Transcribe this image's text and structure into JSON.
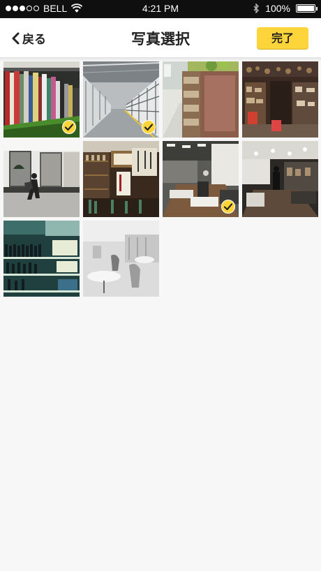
{
  "status_bar": {
    "carrier": "BELL",
    "time": "4:21 PM",
    "battery": "100%"
  },
  "nav": {
    "back_label": "戻る",
    "title": "写真選択",
    "done_label": "完了"
  },
  "photos": [
    {
      "name": "photo-bookshelf",
      "selected": true
    },
    {
      "name": "photo-warehouse-aisle",
      "selected": true
    },
    {
      "name": "photo-store-shelves",
      "selected": false
    },
    {
      "name": "photo-kitchen-shop",
      "selected": false
    },
    {
      "name": "photo-street-pedestrian",
      "selected": false
    },
    {
      "name": "photo-sake-shop",
      "selected": false
    },
    {
      "name": "photo-office-space",
      "selected": true
    },
    {
      "name": "photo-cafe-interior",
      "selected": false
    },
    {
      "name": "photo-bottle-shelves",
      "selected": false
    },
    {
      "name": "photo-white-cafe",
      "selected": false
    }
  ]
}
